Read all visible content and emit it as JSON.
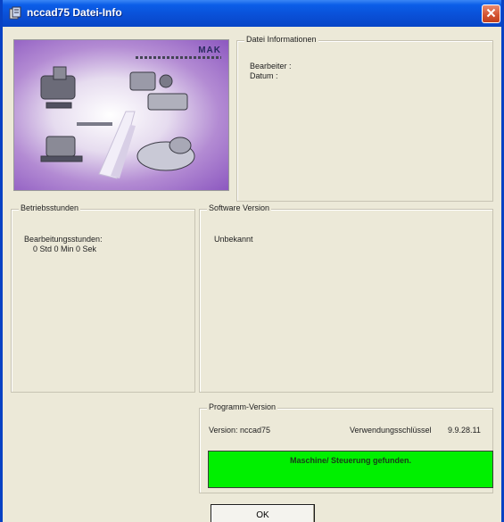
{
  "window": {
    "title": "nccad75 Datei-Info"
  },
  "image": {
    "logo_text": "MAK"
  },
  "datei": {
    "legend": "Datei Informationen",
    "bearbeiter_label": "Bearbeiter :",
    "datum_label": "Datum :"
  },
  "betrieb": {
    "legend": "Betriebsstunden",
    "label": "Bearbeitungsstunden:",
    "value": "0 Std  0 Min  0 Sek"
  },
  "software": {
    "legend": "Software Version",
    "value": "Unbekannt"
  },
  "programm": {
    "legend": "Programm-Version",
    "version": "Version: nccad75",
    "key_label": "Verwendungsschlüssel",
    "key_value": "9.9.28.11",
    "status": "Maschine/ Steuerung gefunden."
  },
  "buttons": {
    "ok": "OK"
  },
  "colors": {
    "titlebar": "#0a4fd6",
    "status_ok": "#00f000",
    "dialog_bg": "#ece9d8"
  },
  "icons": {
    "app": "app-icon",
    "close": "close-icon"
  }
}
